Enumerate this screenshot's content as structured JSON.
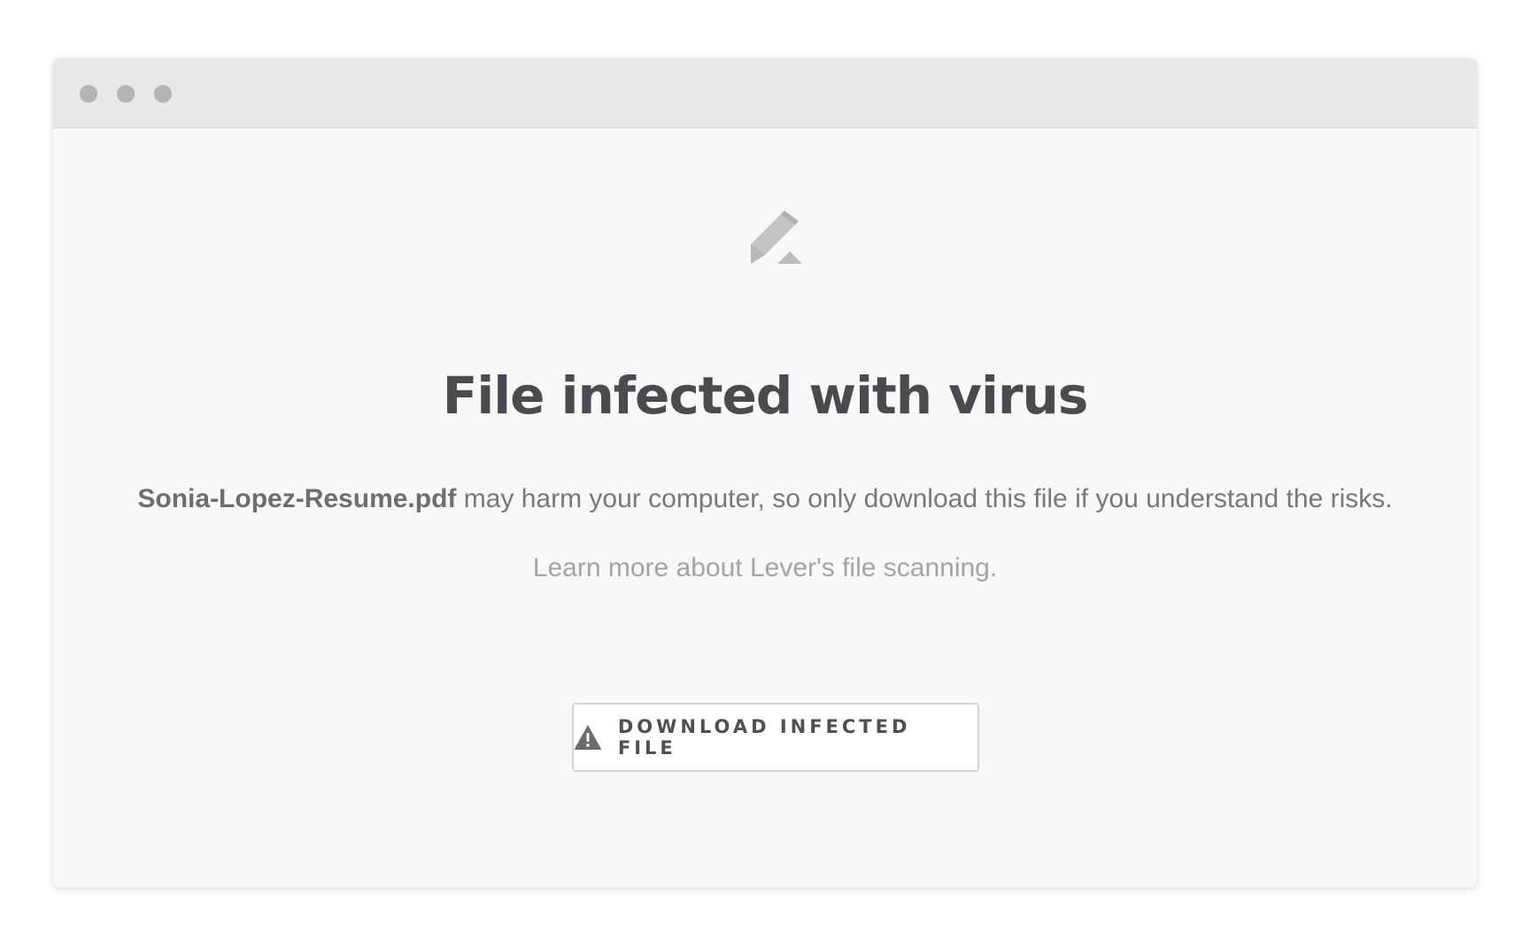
{
  "window": {
    "controls": [
      "close",
      "minimize",
      "zoom"
    ]
  },
  "logo": {
    "icon": "lever-logo-icon"
  },
  "heading": "File infected with virus",
  "message": {
    "filename": "Sonia-Lopez-Resume.pdf",
    "text": " may harm your computer, so only download this file if you understand the risks."
  },
  "learn_more": "Learn more about Lever's file scanning.",
  "download_button": {
    "icon": "warning-icon",
    "label": "DOWNLOAD INFECTED FILE"
  },
  "colors": {
    "window_bg": "#f8f8f8",
    "titlebar_bg": "#e8e8e8",
    "heading": "#4a4a4f",
    "muted_text": "#77777c",
    "link_text": "#a4a4a8"
  }
}
